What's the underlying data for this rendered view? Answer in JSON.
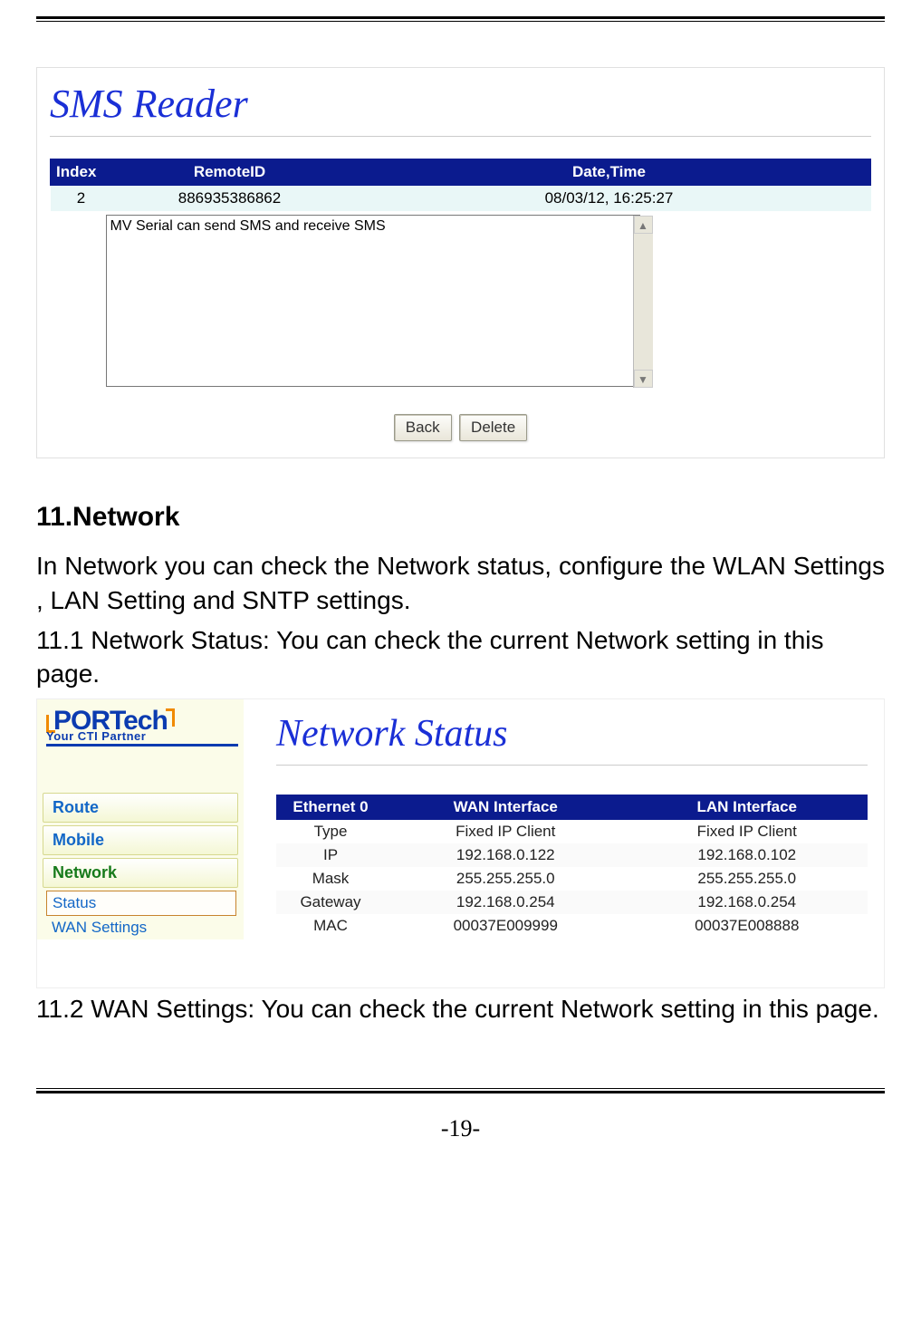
{
  "sms": {
    "title": "SMS Reader",
    "headers": {
      "index": "Index",
      "remote": "RemoteID",
      "datetime": "Date,Time"
    },
    "row": {
      "index": "2",
      "remote": "886935386862",
      "datetime": "08/03/12, 16:25:27"
    },
    "message": "MV Serial can send SMS and receive SMS",
    "buttons": {
      "back": "Back",
      "delete": "Delete"
    }
  },
  "section": {
    "heading": "11.Network",
    "intro": "In Network you can check the Network status, configure the WLAN Settings , LAN Setting and SNTP settings.",
    "p11_1": "11.1 Network Status: You can check the current Network setting in this page.",
    "p11_2": "11.2 WAN Settings: You can check the current Network setting in this page."
  },
  "net": {
    "logo_main": "PORTech",
    "logo_sub": "Your CTI Partner",
    "title": "Network Status",
    "menu": {
      "route": "Route",
      "mobile": "Mobile",
      "network": "Network"
    },
    "submenu": {
      "status": "Status",
      "wan": "WAN Settings"
    },
    "headers": {
      "eth": "Ethernet 0",
      "wan": "WAN Interface",
      "lan": "LAN Interface"
    },
    "rows": [
      {
        "label": "Type",
        "wan": "Fixed IP Client",
        "lan": "Fixed IP Client"
      },
      {
        "label": "IP",
        "wan": "192.168.0.122",
        "lan": "192.168.0.102"
      },
      {
        "label": "Mask",
        "wan": "255.255.255.0",
        "lan": "255.255.255.0"
      },
      {
        "label": "Gateway",
        "wan": "192.168.0.254",
        "lan": "192.168.0.254"
      },
      {
        "label": "MAC",
        "wan": "00037E009999",
        "lan": "00037E008888"
      }
    ]
  },
  "page_number": "-19-"
}
